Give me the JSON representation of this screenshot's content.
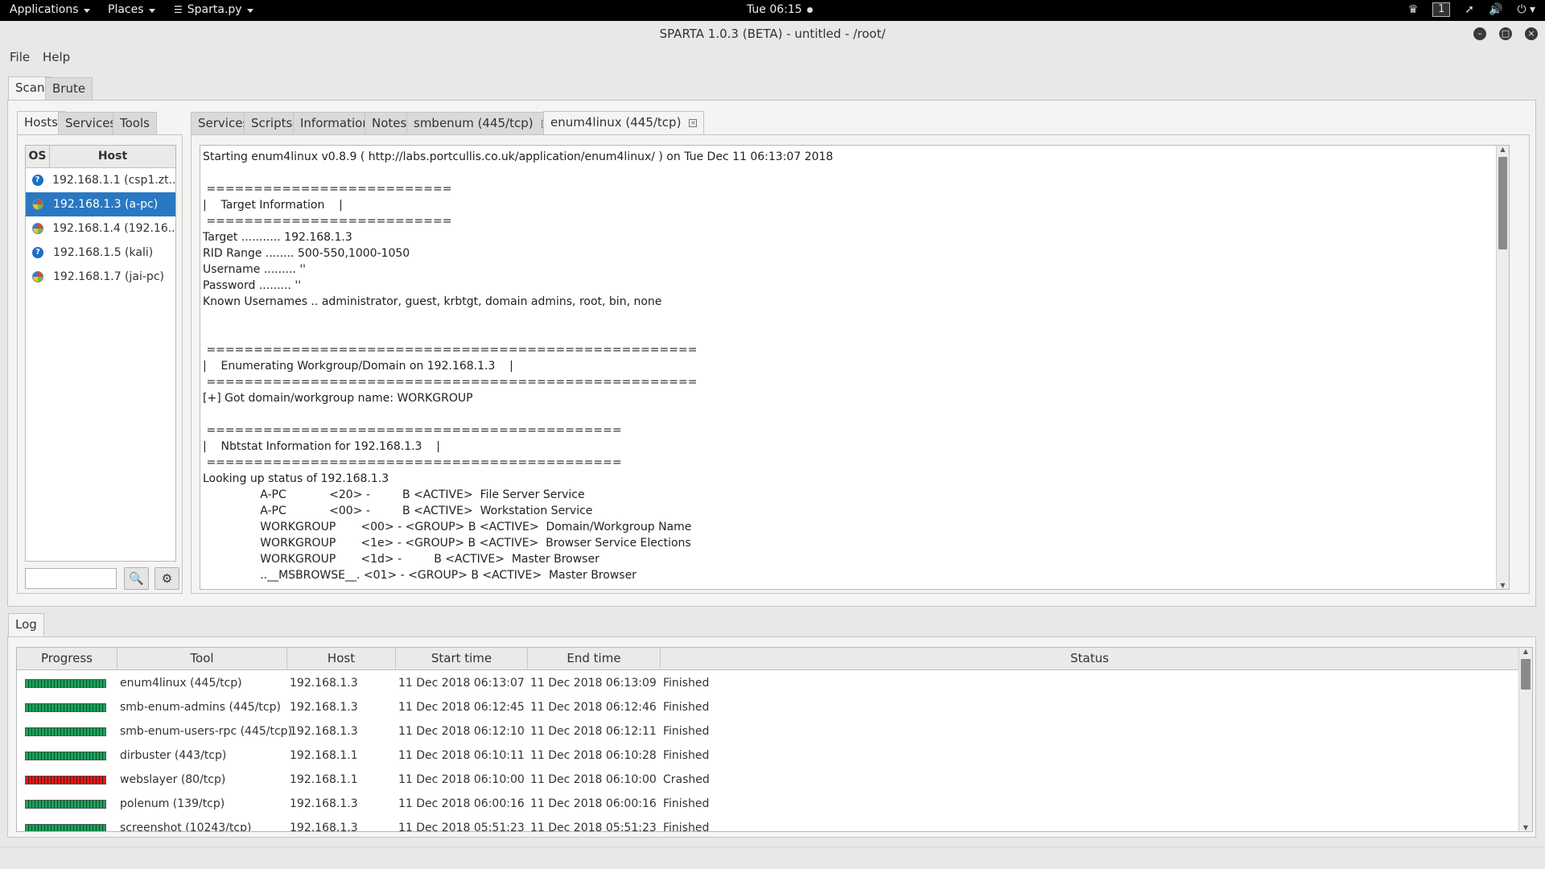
{
  "topbar": {
    "applications": "Applications",
    "places": "Places",
    "app_menu": "Sparta.py",
    "clock": "Tue 06:15",
    "workspace": "1",
    "icons": [
      "people-icon",
      "workspace-indicator",
      "network-icon",
      "volume-icon",
      "power-icon"
    ]
  },
  "window": {
    "title": "SPARTA 1.0.3 (BETA) - untitled - /root/"
  },
  "menubar": {
    "file": "File",
    "help": "Help"
  },
  "main_tabs": [
    "Scan",
    "Brute"
  ],
  "left_tabs": [
    "Hosts",
    "Services",
    "Tools"
  ],
  "host_table": {
    "col_os": "OS",
    "col_host": "Host",
    "rows": [
      {
        "os": "unknown",
        "host": "192.168.1.1 (csp1.zt..."
      },
      {
        "os": "windows",
        "host": "192.168.1.3 (a-pc)",
        "selected": true
      },
      {
        "os": "windows",
        "host": "192.168.1.4 (192.16..."
      },
      {
        "os": "unknown",
        "host": "192.168.1.5 (kali)"
      },
      {
        "os": "windows",
        "host": "192.168.1.7 (jai-pc)"
      }
    ]
  },
  "right_tabs": {
    "services": "Services",
    "scripts": "Scripts",
    "information": "Information",
    "notes": "Notes",
    "smbenum": "smbenum (445/tcp)",
    "enum4linux": "enum4linux (445/tcp)"
  },
  "output_lines": [
    "Starting enum4linux v0.8.9 ( http://labs.portcullis.co.uk/application/enum4linux/ ) on Tue Dec 11 06:13:07 2018",
    "",
    " ==========================",
    "|    Target Information    |",
    " ==========================",
    "Target ........... 192.168.1.3",
    "RID Range ........ 500-550,1000-1050",
    "Username ......... ''",
    "Password ......... ''",
    "Known Usernames .. administrator, guest, krbtgt, domain admins, root, bin, none",
    "",
    "",
    " ====================================================",
    "|    Enumerating Workgroup/Domain on 192.168.1.3    |",
    " ====================================================",
    "[+] Got domain/workgroup name: WORKGROUP",
    "",
    " ============================================",
    "|    Nbtstat Information for 192.168.1.3    |",
    " ============================================",
    "Looking up status of 192.168.1.3",
    "                A-PC            <20> -         B <ACTIVE>  File Server Service",
    "                A-PC            <00> -         B <ACTIVE>  Workstation Service",
    "                WORKGROUP       <00> - <GROUP> B <ACTIVE>  Domain/Workgroup Name",
    "                WORKGROUP       <1e> - <GROUP> B <ACTIVE>  Browser Service Elections",
    "                WORKGROUP       <1d> -         B <ACTIVE>  Master Browser",
    "                ..__MSBROWSE__. <01> - <GROUP> B <ACTIVE>  Master Browser"
  ],
  "log": {
    "tab": "Log",
    "columns": [
      "Progress",
      "Tool",
      "Host",
      "Start time",
      "End time",
      "Status"
    ],
    "rows": [
      {
        "progress": 1.0,
        "tool": "enum4linux (445/tcp)",
        "host": "192.168.1.3",
        "start": "11 Dec 2018 06:13:07",
        "end": "11 Dec 2018 06:13:09",
        "status": "Finished",
        "color": "#1aa35a"
      },
      {
        "progress": 1.0,
        "tool": "smb-enum-admins (445/tcp)",
        "host": "192.168.1.3",
        "start": "11 Dec 2018 06:12:45",
        "end": "11 Dec 2018 06:12:46",
        "status": "Finished",
        "color": "#1aa35a"
      },
      {
        "progress": 1.0,
        "tool": "smb-enum-users-rpc (445/tcp)",
        "host": "192.168.1.3",
        "start": "11 Dec 2018 06:12:10",
        "end": "11 Dec 2018 06:12:11",
        "status": "Finished",
        "color": "#1aa35a"
      },
      {
        "progress": 1.0,
        "tool": "dirbuster (443/tcp)",
        "host": "192.168.1.1",
        "start": "11 Dec 2018 06:10:11",
        "end": "11 Dec 2018 06:10:28",
        "status": "Finished",
        "color": "#1aa35a"
      },
      {
        "progress": 1.0,
        "tool": "webslayer (80/tcp)",
        "host": "192.168.1.1",
        "start": "11 Dec 2018 06:10:00",
        "end": "11 Dec 2018 06:10:00",
        "status": "Crashed",
        "color": "#e01a1a"
      },
      {
        "progress": 1.0,
        "tool": "polenum (139/tcp)",
        "host": "192.168.1.3",
        "start": "11 Dec 2018 06:00:16",
        "end": "11 Dec 2018 06:00:16",
        "status": "Finished",
        "color": "#1aa35a"
      },
      {
        "progress": 1.0,
        "tool": "screenshot (10243/tcp)",
        "host": "192.168.1.3",
        "start": "11 Dec 2018 05:51:23",
        "end": "11 Dec 2018 05:51:23",
        "status": "Finished",
        "color": "#1aa35a"
      }
    ]
  }
}
